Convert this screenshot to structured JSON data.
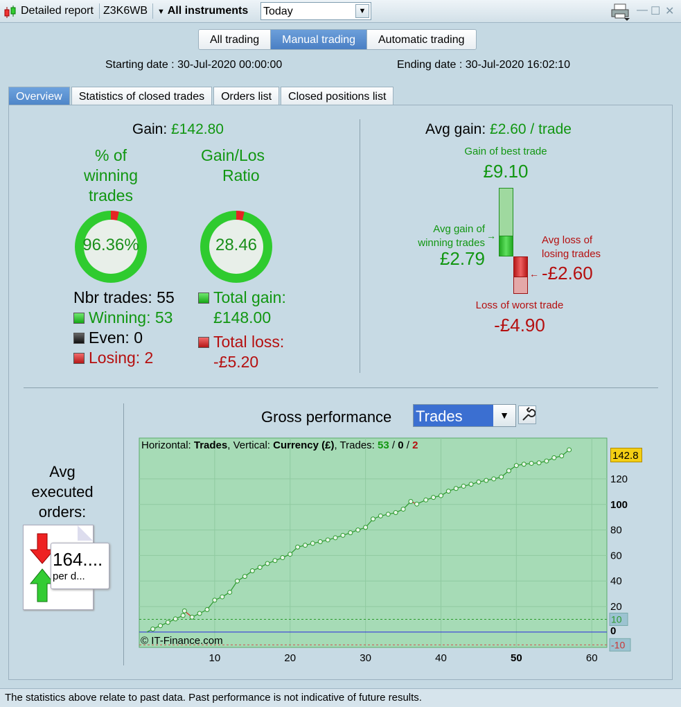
{
  "titlebar": {
    "report_label": "Detailed report",
    "account": "Z3K6WB",
    "instruments_label": "All instruments",
    "period_value": "Today",
    "icons": [
      "candlestick-icon",
      "printer-icon",
      "minimize-icon",
      "maximize-icon",
      "close-icon"
    ]
  },
  "mode_tabs": [
    {
      "label": "All trading",
      "active": false
    },
    {
      "label": "Manual trading",
      "active": true
    },
    {
      "label": "Automatic trading",
      "active": false
    }
  ],
  "dates": {
    "start": "Starting date : 30-Jul-2020 00:00:00",
    "end": "Ending date : 30-Jul-2020 16:02:10"
  },
  "tabs": [
    {
      "label": "Overview",
      "active": true
    },
    {
      "label": "Statistics of closed trades",
      "active": false
    },
    {
      "label": "Orders list",
      "active": false
    },
    {
      "label": "Closed positions list",
      "active": false
    }
  ],
  "overview": {
    "gain_label": "Gain:",
    "gain_value": "£142.80",
    "winning_pct_title": [
      "% of",
      "winning",
      "trades"
    ],
    "winning_pct_value": "96.36%",
    "winning_fraction": 0.9636,
    "gain_loss_title": [
      "Gain/Los",
      "Ratio"
    ],
    "gain_loss_value": "28.46",
    "nbr_trades": "Nbr trades: 55",
    "winning": "Winning: 53",
    "even": "Even: 0",
    "losing": "Losing: 2",
    "total_gain_label": "Total gain:",
    "total_gain_value": "£148.00",
    "total_loss_label": "Total loss:",
    "total_loss_value": "-£5.20"
  },
  "avg": {
    "avg_gain_label": "Avg gain:",
    "avg_gain_value": "£2.60 / trade",
    "best_label": "Gain of best trade",
    "best_value": "£9.10",
    "avg_win_label": [
      "Avg gain of",
      "winning trades"
    ],
    "avg_win_value": "£2.79",
    "avg_loss_label": [
      "Avg loss of",
      "losing trades"
    ],
    "avg_loss_value": "-£2.60",
    "worst_label": "Loss of worst trade",
    "worst_value": "-£4.90"
  },
  "executed": {
    "title": [
      "Avg",
      "executed",
      "orders:"
    ],
    "value": "164....",
    "unit": "per d..."
  },
  "performance": {
    "title": "Gross performance",
    "select_value": "Trades",
    "header_prefix": "Horizontal: ",
    "header_h": "Trades",
    "header_mid": ", Vertical: ",
    "header_v": "Currency (£)",
    "header_trades": ", Trades: ",
    "header_win": "53",
    "header_sep1": " / ",
    "header_even": "0",
    "header_sep2": " / ",
    "header_lose": "2",
    "copyright": "© IT-Finance.com",
    "current_value_label": "142.8"
  },
  "chart_data": {
    "type": "line",
    "xlabel": "",
    "ylabel": "",
    "xlim": [
      0,
      62
    ],
    "ylim": [
      -12,
      152
    ],
    "x_ticks": [
      10,
      20,
      30,
      40,
      50,
      60
    ],
    "x_tick_bold": 50,
    "y_ticks": [
      20,
      40,
      60,
      80,
      100,
      120
    ],
    "y_tick_bold": 100,
    "y_extra_labels": [
      "0",
      "10",
      "-10"
    ],
    "threshold_lines": [
      10,
      0,
      -10
    ],
    "colors": {
      "area": "#a6dbb6",
      "line": "#2d9a2d",
      "loss_segment": "#d22",
      "zero_line": "#2a2ae0"
    },
    "series": [
      {
        "values": [
          0,
          2.4,
          5.0,
          7.6,
          10.3,
          13.0,
          16.6,
          11.7,
          14.6,
          17.6,
          25.0,
          27.6,
          31.2,
          40.0,
          43.6,
          48.0,
          50.7,
          53.7,
          56.0,
          58.3,
          61.0,
          66.6,
          68.0,
          69.5,
          70.8,
          72.2,
          73.9,
          75.8,
          77.8,
          80.0,
          82.0,
          88.6,
          91.0,
          92.3,
          93.6,
          96.3,
          102.3,
          100.3,
          103.5,
          105.5,
          106.9,
          110.4,
          112.5,
          114.3,
          115.8,
          117.6,
          118.8,
          120.0,
          121.5,
          126.4,
          130.5,
          131.5,
          132.2,
          132.6,
          134.0,
          136.6,
          138.0,
          142.8
        ],
        "x": [
          1,
          1.8,
          2.8,
          3.8,
          4.8,
          5.8,
          6.0,
          7.0,
          8.0,
          9.0,
          10.0,
          11.0,
          12.0,
          13.0,
          14.0,
          15.0,
          16.0,
          17.0,
          18.0,
          19.0,
          20.0,
          21.0,
          22.0,
          23.0,
          24.0,
          25.0,
          26.0,
          27.0,
          28.0,
          29.0,
          30.0,
          31.0,
          32.0,
          33.0,
          34.0,
          35.0,
          36.0,
          36.8,
          38.0,
          39.0,
          40.0,
          41.0,
          42.0,
          43.0,
          44.0,
          45.0,
          46.0,
          47.0,
          48.0,
          49.0,
          50.0,
          51.0,
          52.0,
          53.0,
          54.0,
          55.0,
          56.0,
          57.0
        ]
      }
    ]
  },
  "status": "The statistics above relate to past data. Past performance is not indicative of future results."
}
